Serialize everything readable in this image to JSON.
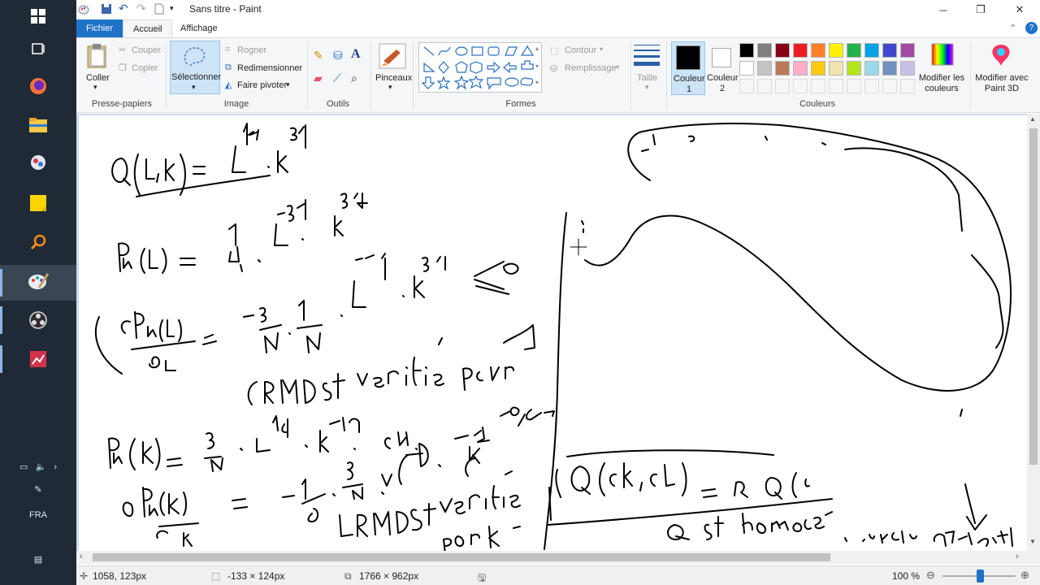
{
  "window": {
    "title": "Sans titre - Paint"
  },
  "tabs": {
    "file": "Fichier",
    "home": "Accueil",
    "view": "Affichage"
  },
  "clipboard": {
    "paste": "Coller",
    "cut": "Couper",
    "copy": "Copier",
    "label": "Presse-papiers"
  },
  "image": {
    "select": "Sélectionner",
    "crop": "Rogner",
    "resize": "Redimensionner",
    "rotate": "Faire pivoter",
    "label": "Image"
  },
  "tools": {
    "label": "Outils"
  },
  "brushes": {
    "label": "Pinceaux"
  },
  "shapes": {
    "outline": "Contour",
    "fill": "Remplissage",
    "label": "Formes"
  },
  "size": {
    "label": "Taille"
  },
  "colors": {
    "color1": "Couleur 1",
    "color2": "Couleur 2",
    "edit": "Modifier les couleurs",
    "paint3d": "Modifier avec Paint 3D",
    "label": "Couleurs",
    "primary": "#000000",
    "secondary": "#ffffff",
    "palette_row1": [
      "#000000",
      "#7f7f7f",
      "#880015",
      "#ed1c24",
      "#ff7f27",
      "#fff200",
      "#22b14c",
      "#00a2e8",
      "#3f48cc",
      "#a349a4"
    ],
    "palette_row2": [
      "#ffffff",
      "#c3c3c3",
      "#b97a57",
      "#ffaec9",
      "#ffc90e",
      "#efe4b0",
      "#b5e61d",
      "#99d9ea",
      "#7092be",
      "#c8bfe7"
    ]
  },
  "tray": {
    "lang": "FRA"
  },
  "status": {
    "cursor": "1058, 123px",
    "selection": "-133 × 124px",
    "image_size": "1766 × 962px",
    "zoom": "100 %"
  }
}
